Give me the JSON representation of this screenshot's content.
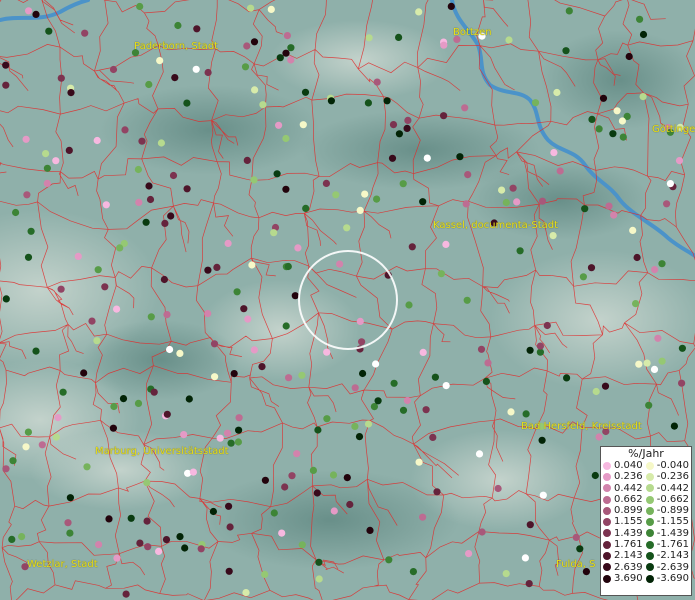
{
  "map": {
    "cities": [
      {
        "name": "Paderborn, Stadt"
      },
      {
        "name": "Bottzen"
      },
      {
        "name": "Göttinge"
      },
      {
        "name": "Kassel, documenta-Stadt"
      },
      {
        "name": "Marburg, Universitätsstadt"
      },
      {
        "name": "Bad Hersfeld, Kreisstadt"
      },
      {
        "name": "Wetzlar, Stadt"
      },
      {
        "name": "Fulda, S"
      }
    ],
    "selection_circle": "circle-marker"
  },
  "legend": {
    "title": "%/Jahr",
    "positive": [
      {
        "label": "0.040",
        "color": "#f7b8e0"
      },
      {
        "label": "0.236",
        "color": "#e59ac6"
      },
      {
        "label": "0.442",
        "color": "#d283ac"
      },
      {
        "label": "0.662",
        "color": "#bd6c92"
      },
      {
        "label": "0.899",
        "color": "#a8587a"
      },
      {
        "label": "1.155",
        "color": "#924464"
      },
      {
        "label": "1.439",
        "color": "#7c3350"
      },
      {
        "label": "1.761",
        "color": "#65233c"
      },
      {
        "label": "2.143",
        "color": "#4e152a"
      },
      {
        "label": "2.639",
        "color": "#380a1b"
      },
      {
        "label": "3.690",
        "color": "#22030c"
      }
    ],
    "negative": [
      {
        "label": "-0.040",
        "color": "#f6f8c8"
      },
      {
        "label": "-0.236",
        "color": "#d7ebaa"
      },
      {
        "label": "-0.442",
        "color": "#b6da8e"
      },
      {
        "label": "-0.662",
        "color": "#95c873"
      },
      {
        "label": "-0.899",
        "color": "#76b35c"
      },
      {
        "label": "-1.155",
        "color": "#579c47"
      },
      {
        "label": "-1.439",
        "color": "#3d8436"
      },
      {
        "label": "-1.761",
        "color": "#266c28"
      },
      {
        "label": "-2.143",
        "color": "#15531b"
      },
      {
        "label": "-2.639",
        "color": "#093b10"
      },
      {
        "label": "-3.690",
        "color": "#022406"
      }
    ]
  }
}
